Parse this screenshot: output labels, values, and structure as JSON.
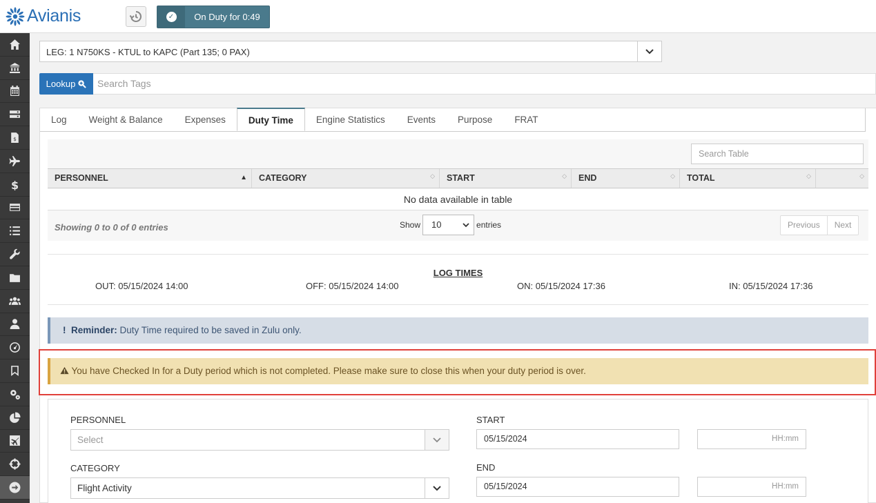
{
  "app": {
    "brand": "Avianis",
    "duty_status": "On Duty for 0:49"
  },
  "leg": {
    "selected": "LEG: 1 N750KS - KTUL to KAPC (Part 135; 0 PAX)"
  },
  "lookup": {
    "button_label": "Lookup",
    "placeholder": "Search Tags"
  },
  "tabs": [
    {
      "label": "Log"
    },
    {
      "label": "Weight & Balance"
    },
    {
      "label": "Expenses"
    },
    {
      "label": "Duty Time"
    },
    {
      "label": "Engine Statistics"
    },
    {
      "label": "Events"
    },
    {
      "label": "Purpose"
    },
    {
      "label": "FRAT"
    }
  ],
  "table": {
    "search_placeholder": "Search Table",
    "columns": [
      "PERSONNEL",
      "CATEGORY",
      "START",
      "END",
      "TOTAL",
      ""
    ],
    "empty_text": "No data available in table",
    "info": "Showing 0 to 0 of 0 entries",
    "show_label": "Show",
    "page_length": "10",
    "entries_label": "entries",
    "prev": "Previous",
    "next": "Next"
  },
  "log_times": {
    "title": "LOG TIMES",
    "out": "OUT: 05/15/2024 14:00",
    "off": "OFF: 05/15/2024 14:00",
    "on": "ON: 05/15/2024 17:36",
    "in": "IN: 05/15/2024 17:36"
  },
  "reminder": {
    "bang": "!",
    "label": "Reminder:",
    "text": " Duty Time required to be saved in Zulu only."
  },
  "warning": {
    "text": "You have Checked In for a Duty period which is not completed. Please make sure to close this when your duty period is over."
  },
  "form": {
    "personnel_label": "PERSONNEL",
    "personnel_value": "Select",
    "category_label": "CATEGORY",
    "category_value": "Flight Activity",
    "start_label": "START",
    "start_date": "05/15/2024",
    "start_time_placeholder": "HH:mm",
    "end_label": "END",
    "end_date": "05/15/2024",
    "end_time_placeholder": "HH:mm"
  },
  "sidebar": {
    "icons": [
      "home-icon",
      "bank-icon",
      "calendar-icon",
      "server-icon",
      "invoice-icon",
      "plane-icon",
      "dollar-icon",
      "credit-card-icon",
      "list-icon",
      "wrench-icon",
      "folder-icon",
      "users-icon",
      "user-icon",
      "dashboard-icon",
      "bookmark-icon",
      "cogs-icon",
      "pie-chart-icon",
      "flight-board-icon",
      "crosshair-icon",
      "arrow-right-icon"
    ]
  },
  "colors": {
    "brand_blue": "#2a73b8",
    "duty_teal": "#4a7a8c",
    "warning_bg": "#f1e1b2",
    "reminder_bg": "#d6dde6",
    "highlight_red": "#e0403a"
  }
}
